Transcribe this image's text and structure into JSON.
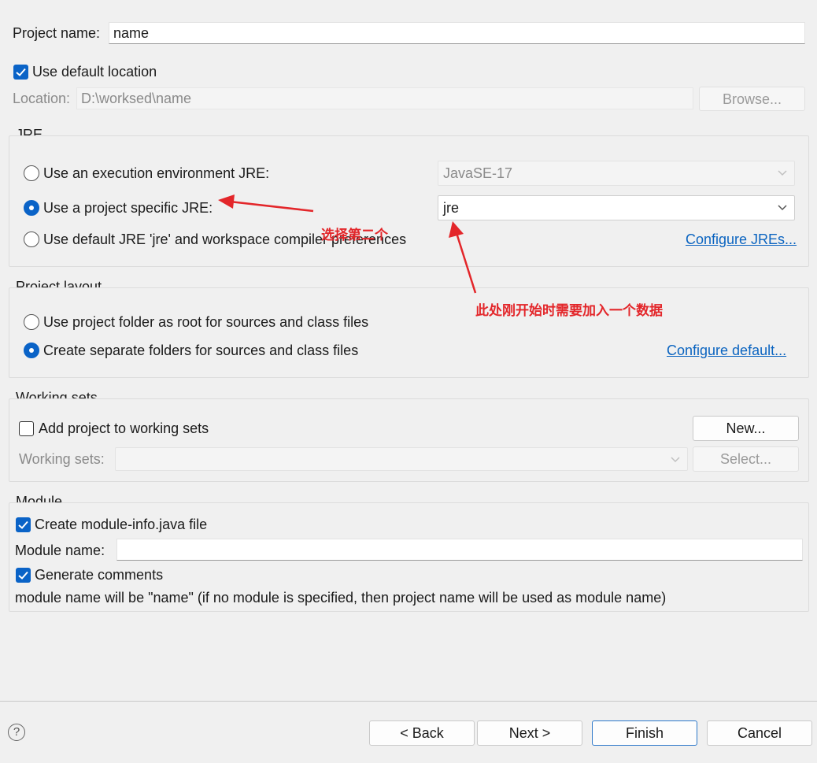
{
  "project": {
    "name_label": "Project name:",
    "name_value": "name",
    "use_default_location_label": "Use default location",
    "use_default_location_checked": true,
    "location_label": "Location:",
    "location_value": "D:\\worksed\\name",
    "browse_label": "Browse..."
  },
  "jre": {
    "title": "JRE",
    "options": [
      {
        "label": "Use an execution environment JRE:",
        "selected": false
      },
      {
        "label": "Use a project specific JRE:",
        "selected": true
      },
      {
        "label": "Use default JRE 'jre' and workspace compiler preferences",
        "selected": false
      }
    ],
    "execution_env_value": "JavaSE-17",
    "project_jre_value": "jre",
    "configure_link": "Configure JREs..."
  },
  "layout": {
    "title": "Project layout",
    "options": [
      {
        "label": "Use project folder as root for sources and class files",
        "selected": false
      },
      {
        "label": "Create separate folders for sources and class files",
        "selected": true
      }
    ],
    "configure_link": "Configure default..."
  },
  "working_sets": {
    "title": "Working sets",
    "add_label": "Add project to working sets",
    "add_checked": false,
    "new_label": "New...",
    "sets_label": "Working sets:",
    "sets_value": "",
    "select_label": "Select..."
  },
  "module": {
    "title": "Module",
    "create_label": "Create module-info.java file",
    "create_checked": true,
    "name_label": "Module name:",
    "name_value": "",
    "comments_label": "Generate comments",
    "comments_checked": true,
    "info_text": "module name will be \"name\"  (if no module is specified, then project name will be used as module name)"
  },
  "footer": {
    "help_glyph": "?",
    "back_label": "< Back",
    "next_label": "Next >",
    "finish_label": "Finish",
    "cancel_label": "Cancel"
  },
  "annotations": {
    "select_second": "选择第二个",
    "add_data_note": "此处刚开始时需要加入一个数据",
    "color": "#e3262a"
  },
  "colors": {
    "accent": "#0a63c7",
    "link": "#0b64c0",
    "background": "#f0f0f0"
  }
}
